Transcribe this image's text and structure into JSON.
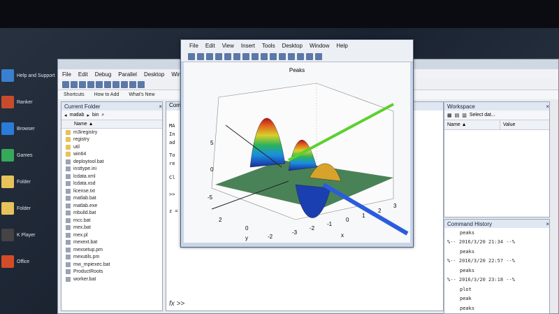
{
  "desktop": {
    "left_icons": [
      {
        "label": "Help and Support",
        "color": "#3a7fd0"
      },
      {
        "label": "Ranker",
        "color": "#c84c2b"
      },
      {
        "label": "Browser",
        "color": "#2b7bd8"
      },
      {
        "label": "Games",
        "color": "#35a85a"
      },
      {
        "label": "Folder",
        "color": "#e6c25a"
      },
      {
        "label": "Folder",
        "color": "#e6c25a"
      },
      {
        "label": "K Player",
        "color": "#444"
      },
      {
        "label": "Office",
        "color": "#d34c28"
      }
    ]
  },
  "matlab": {
    "menu": [
      "File",
      "Edit",
      "Debug",
      "Parallel",
      "Desktop",
      "Window"
    ],
    "shortcuts": [
      "Shortcuts",
      "How to Add",
      "What's New"
    ],
    "current_folder": {
      "title": "Current Folder",
      "path": [
        "matlab",
        "bin"
      ],
      "column": "Name ▲",
      "files": [
        {
          "name": "m3iregistry",
          "type": "folder"
        },
        {
          "name": "registry",
          "type": "folder"
        },
        {
          "name": "util",
          "type": "folder"
        },
        {
          "name": "win64",
          "type": "folder"
        },
        {
          "name": "deploytool.bat",
          "type": "file"
        },
        {
          "name": "insttype.ini",
          "type": "file"
        },
        {
          "name": "lcdata.xml",
          "type": "file"
        },
        {
          "name": "lcdata.xsd",
          "type": "file"
        },
        {
          "name": "license.txt",
          "type": "file"
        },
        {
          "name": "matlab.bat",
          "type": "file"
        },
        {
          "name": "matlab.exe",
          "type": "file"
        },
        {
          "name": "mbuild.bat",
          "type": "file"
        },
        {
          "name": "mcc.bat",
          "type": "file"
        },
        {
          "name": "mex.bat",
          "type": "file"
        },
        {
          "name": "mex.pl",
          "type": "file"
        },
        {
          "name": "mexext.bat",
          "type": "file"
        },
        {
          "name": "mexsetup.pm",
          "type": "file"
        },
        {
          "name": "mexutils.pm",
          "type": "file"
        },
        {
          "name": "mw_mpiexec.bat",
          "type": "file"
        },
        {
          "name": "ProductRoots",
          "type": "file"
        },
        {
          "name": "worker.bat",
          "type": "file"
        }
      ]
    },
    "command_window": {
      "tab": "Comm",
      "lines": [
        "MA",
        "In",
        "ad",
        "To",
        "re",
        "Cl",
        ">>",
        "z ="
      ],
      "prompt": ">>"
    },
    "workspace": {
      "title": "Workspace",
      "select": "Select dat...",
      "columns": [
        "Name ▲",
        "Value"
      ]
    },
    "command_history": {
      "title": "Command History",
      "items": [
        {
          "text": "peaks",
          "kind": "cmd"
        },
        {
          "text": "%-- 2016/3/20 21:34 --%",
          "kind": "sess"
        },
        {
          "text": "peaks",
          "kind": "cmd"
        },
        {
          "text": "%-- 2016/3/20 22:57 --%",
          "kind": "sess"
        },
        {
          "text": "peaks",
          "kind": "cmd"
        },
        {
          "text": "%-- 2016/3/20 23:18 --%",
          "kind": "sess"
        },
        {
          "text": "plot",
          "kind": "cmd"
        },
        {
          "text": "peak",
          "kind": "cmd"
        },
        {
          "text": "peaks",
          "kind": "cmd"
        }
      ]
    }
  },
  "figure": {
    "menu": [
      "File",
      "Edit",
      "View",
      "Insert",
      "Tools",
      "Desktop",
      "Window",
      "Help"
    ],
    "title": "Peaks",
    "x_label": "x",
    "y_label": "y",
    "z_ticks": [
      "5",
      "0",
      "-5"
    ],
    "x_ticks": [
      "-3",
      "-2",
      "-1",
      "0",
      "1",
      "2",
      "3"
    ],
    "y_ticks": [
      "2",
      "0",
      "-2"
    ]
  }
}
